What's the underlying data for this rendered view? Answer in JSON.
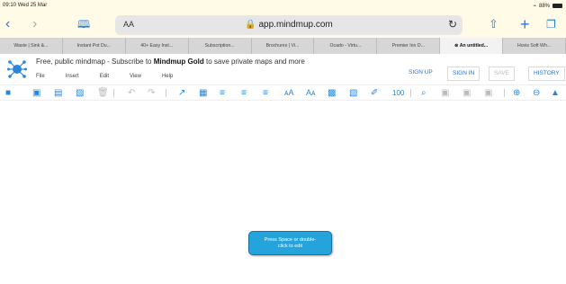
{
  "status": {
    "time": "09:10",
    "date": "Wed 25 Mar",
    "battery": "88%"
  },
  "browser": {
    "aa_label": "AA",
    "url": "app.mindmup.com",
    "tabs": [
      {
        "label": "Waste | Sink &...",
        "active": false
      },
      {
        "label": "Instant Pot Du...",
        "active": false
      },
      {
        "label": "40+ Easy Inst...",
        "active": false
      },
      {
        "label": "Subscription...",
        "active": false
      },
      {
        "label": "Brochures | Vi...",
        "active": false
      },
      {
        "label": "Ocado - Virtu...",
        "active": false
      },
      {
        "label": "Premier Inn D...",
        "active": false
      },
      {
        "label": "An untitled...",
        "active": true
      },
      {
        "label": "Hovis Soft Wh...",
        "active": false
      }
    ]
  },
  "app": {
    "promo_prefix": "Free, public mindmap - Subscribe to",
    "promo_brand": "Mindmup Gold",
    "promo_suffix": "to save private maps and more",
    "menu": {
      "file": "File",
      "insert": "Insert",
      "edit": "Edit",
      "view": "View",
      "help": "Help"
    },
    "buttons": {
      "sign_up": "SIGN UP",
      "sign_in": "SIGN IN",
      "save": "SAVE",
      "history": "HISTORY"
    },
    "root_node": {
      "line1": "Press Space or double-",
      "line2": "click to edit"
    }
  },
  "colors": {
    "accent": "#2a86d9",
    "node_fill": "#25a4dc",
    "background_frame": "#fffbe6"
  }
}
